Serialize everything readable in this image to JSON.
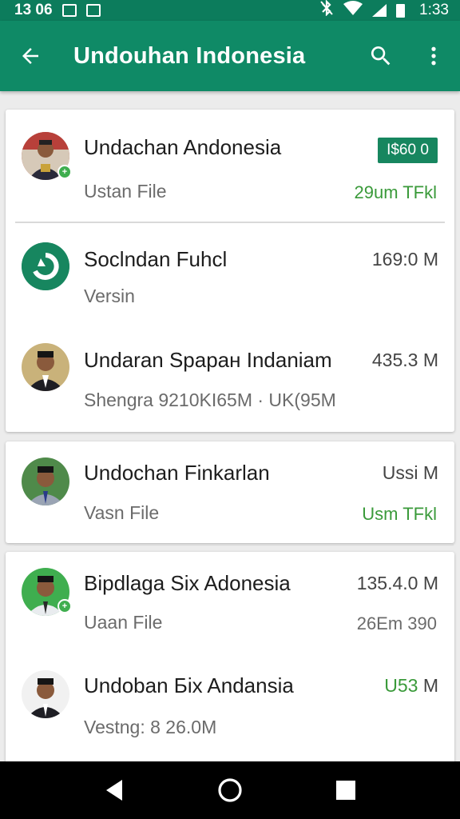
{
  "status_bar": {
    "left_text": "13 06",
    "time": "1:33"
  },
  "app_bar": {
    "title": "Undouhan Indonesia",
    "icons": [
      "arrow-back-icon",
      "search-icon",
      "more-vert-icon"
    ]
  },
  "items": [
    {
      "title": "Undachan Andonesia",
      "subtitle": "Ustan File",
      "chip": "I$60 0",
      "meta": "29um TFkl",
      "avatar": "person-avatar",
      "badge": "+"
    },
    {
      "title": "Soclndan Fuhcl",
      "subtitle": "Versin",
      "size": "169:0 M",
      "avatar": "app-logo-icon"
    },
    {
      "title": "Undaran Spaран Indaniam",
      "subtitle": "Shengra 9210KI65M · UK(95M",
      "size": "435.3 M",
      "avatar": "person-avatar"
    },
    {
      "title": "Undochan Finkarlan",
      "subtitle": "Vasn File",
      "size": "Ussi M",
      "meta": "Usm TFkl",
      "avatar": "person-avatar"
    },
    {
      "title": "Bipdlaga Six Adonesia",
      "subtitle": "Uaan File",
      "size": "135.4.0  M",
      "meta": "26Em 390",
      "avatar": "person-avatar",
      "badge": "+"
    },
    {
      "title": "Undoban Бix Andansia",
      "subtitle": "Vestng: 8 26.0M",
      "size_green": "U53",
      "size_unit": "M",
      "avatar": "person-avatar"
    }
  ],
  "colors": {
    "status_bar": "#0c7c5c",
    "app_bar": "#0f8a66",
    "accent_green": "#3a9a3a",
    "chip": "#17865f"
  }
}
